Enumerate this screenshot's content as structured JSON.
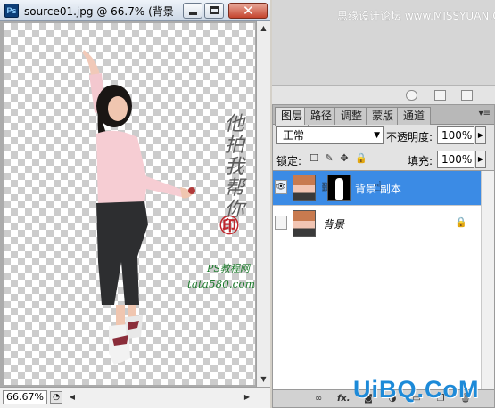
{
  "document": {
    "app_icon": "Ps",
    "title": "source01.jpg @ 66.7% (背景",
    "zoom": "66.67%",
    "watermark": {
      "calligraphy": "他拍我帮你",
      "seal": "㊞",
      "caption": "PS教程网",
      "url": "tata580.com"
    }
  },
  "top_banner": "思缘设计论坛 www.MISSYUAN.COM",
  "layers_panel": {
    "tabs": [
      "图层",
      "路径",
      "调整",
      "蒙版",
      "通道"
    ],
    "active_tab": 0,
    "blend_mode": "正常",
    "opacity_label": "不透明度:",
    "opacity_value": "100%",
    "lock_label": "锁定:",
    "fill_label": "填充:",
    "fill_value": "100%",
    "layers": [
      {
        "name": "背景 副本",
        "selected": true,
        "visible": true,
        "has_mask": true
      },
      {
        "name": "背景",
        "selected": false,
        "visible": false,
        "locked": true
      }
    ],
    "footer_icons": [
      "link-icon",
      "fx-icon",
      "mask-icon",
      "adjust-icon",
      "folder-icon",
      "new-layer-icon",
      "trash-icon"
    ],
    "fx_label": "fx."
  },
  "footer_brand": "UiBQ.CoM",
  "colors": {
    "selection": "#3b8be5",
    "watermark_green": "#1e7a2d",
    "seal_red": "#c0272d",
    "brand_blue": "#1d8ad8"
  }
}
